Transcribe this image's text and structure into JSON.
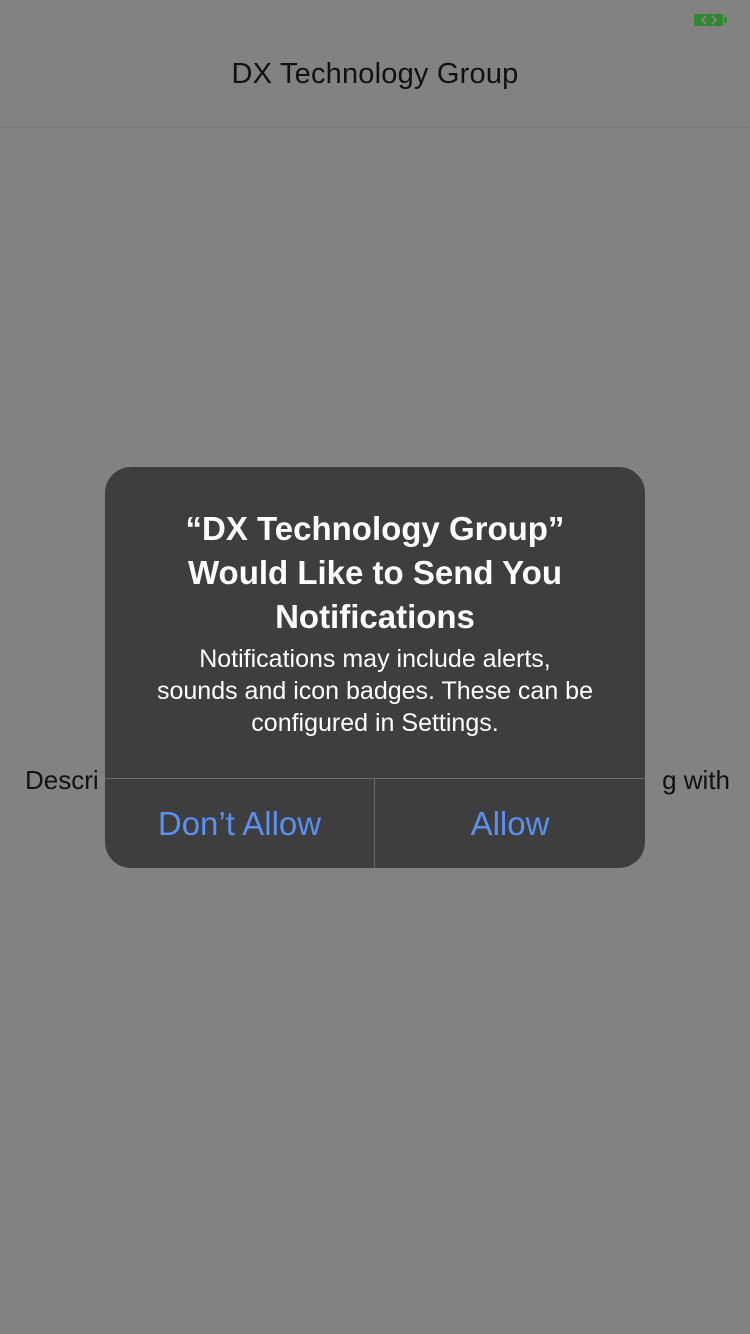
{
  "nav": {
    "title": "DX Technology Group"
  },
  "content": {
    "description_visible_start": "Descri",
    "description_visible_end": "g with"
  },
  "alert": {
    "title": "“DX Technology Group” Would Like to Send You Notifications",
    "title_lines": "“DX Technology Group”\nWould Like to Send You\nNotifications",
    "message_lines": "Notifications may include alerts,\nsounds and icon badges. These can be\nconfigured in Settings.",
    "buttons": {
      "dont_allow": "Don’t Allow",
      "allow": "Allow"
    }
  },
  "colors": {
    "background": "#828282",
    "alert_background": "#3e3e3e",
    "button_text": "#5b8ff0",
    "battery": "#2f8a2f"
  },
  "icons": {
    "status": "battery-icon"
  }
}
